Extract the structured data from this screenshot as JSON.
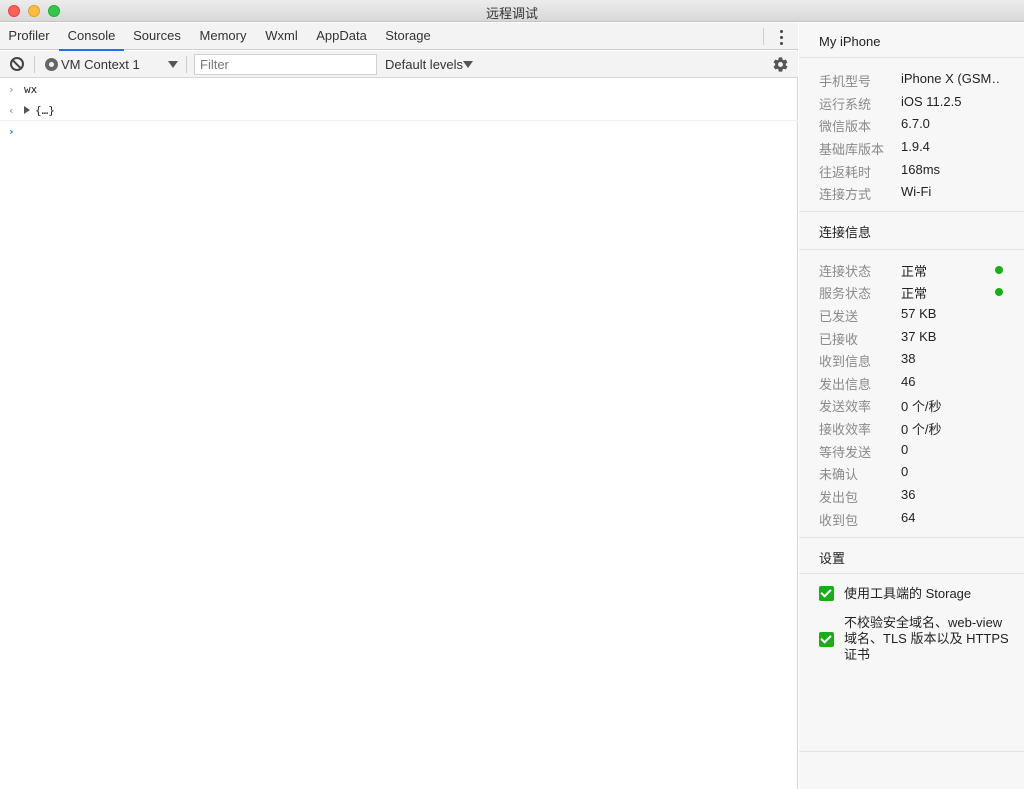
{
  "window": {
    "title": "远程调试"
  },
  "tabs": [
    {
      "label": "Profiler"
    },
    {
      "label": "Console"
    },
    {
      "label": "Sources"
    },
    {
      "label": "Memory"
    },
    {
      "label": "Wxml"
    },
    {
      "label": "AppData"
    },
    {
      "label": "Storage"
    }
  ],
  "active_tab": "Console",
  "toolbar": {
    "context": "VM Context 1",
    "filter_placeholder": "Filter",
    "filter_value": "",
    "levels": "Default levels"
  },
  "console": {
    "input": "wx",
    "output": "{…}",
    "input_chevron": "›",
    "output_chevron": "‹",
    "prompt_chevron": "›"
  },
  "device": {
    "title": "My iPhone",
    "rows": [
      {
        "key": "手机型号",
        "value": "iPhone X (GSM…"
      },
      {
        "key": "运行系统",
        "value": "iOS 11.2.5"
      },
      {
        "key": "微信版本",
        "value": "6.7.0"
      },
      {
        "key": "基础库版本",
        "value": "1.9.4"
      },
      {
        "key": "往返耗时",
        "value": "168ms"
      },
      {
        "key": "连接方式",
        "value": "Wi-Fi"
      }
    ]
  },
  "connection": {
    "title": "连接信息",
    "rows": [
      {
        "key": "连接状态",
        "value": "正常"
      },
      {
        "key": "服务状态",
        "value": "正常"
      },
      {
        "key": "已发送",
        "value": "57 KB"
      },
      {
        "key": "已接收",
        "value": "37 KB"
      },
      {
        "key": "收到信息",
        "value": "38"
      },
      {
        "key": "发出信息",
        "value": "46"
      },
      {
        "key": "发送效率",
        "value": "0 个/秒"
      },
      {
        "key": "接收效率",
        "value": "0 个/秒"
      },
      {
        "key": "等待发送",
        "value": "0"
      },
      {
        "key": "未确认",
        "value": "0"
      },
      {
        "key": "发出包",
        "value": "36"
      },
      {
        "key": "收到包",
        "value": "64"
      }
    ],
    "status_color": "#1aad19"
  },
  "settings": {
    "title": "设置",
    "options": [
      {
        "label": "使用工具端的 Storage",
        "checked": true
      },
      {
        "label": "不校验安全域名、web-view 域名、TLS 版本以及 HTTPS 证书",
        "checked": true
      }
    ]
  },
  "colors": {
    "accent": "#1a73e8",
    "wechat_green": "#1aad19"
  }
}
